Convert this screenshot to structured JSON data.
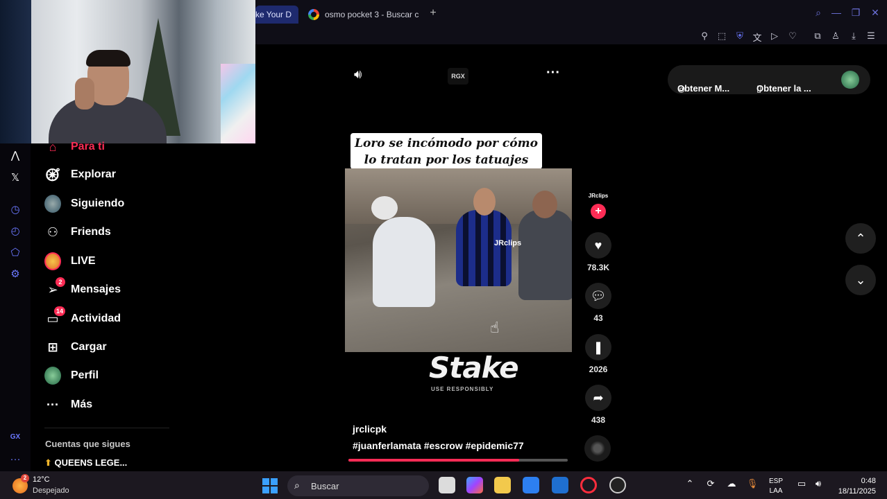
{
  "browser": {
    "tabs": [
      {
        "label": "ke Your D",
        "active": true
      },
      {
        "label": "osmo pocket 3 - Buscar c",
        "active": false
      }
    ],
    "new_tab_icon": "plus-icon"
  },
  "sidebar": {
    "items": [
      {
        "label": "Para ti",
        "icon": "home-icon",
        "active": true
      },
      {
        "label": "Explorar",
        "icon": "compass-icon"
      },
      {
        "label": "Siguiendo",
        "icon": "avatar"
      },
      {
        "label": "Friends",
        "icon": "friends-icon"
      },
      {
        "label": "LIVE",
        "icon": "live-avatar"
      },
      {
        "label": "Mensajes",
        "icon": "send-icon",
        "badge": "2"
      },
      {
        "label": "Actividad",
        "icon": "inbox-icon",
        "badge": "14"
      },
      {
        "label": "Cargar",
        "icon": "upload-icon"
      },
      {
        "label": "Perfil",
        "icon": "avatar"
      },
      {
        "label": "Más",
        "icon": "more-icon"
      }
    ],
    "following_header": "Cuentas que sigues",
    "following": [
      {
        "name": "QUEENS LEGE..."
      }
    ]
  },
  "player": {
    "rgx_label": "RGX",
    "caption": "Loro se incómodo por cómo lo tratan por los tatuajes",
    "watermark": "JRclips",
    "ad_brand": "Stake",
    "ad_sub": "USE RESPONSIBLY",
    "author": "jrclicpk",
    "hashtags": "#juanferlamata #escrow #epidemic77",
    "progress": 0.78
  },
  "actions": {
    "creator_label": "JRclips",
    "likes": "78.3K",
    "comments": "43",
    "saves": "2026",
    "shares": "438"
  },
  "top_right": {
    "btn1": "Obtener M...",
    "btn2": "Obtener la ..."
  },
  "taskbar": {
    "temperature": "12°C",
    "weather": "Despejado",
    "weather_badge": "2",
    "search_placeholder": "Buscar",
    "lang_line1": "ESP",
    "lang_line2": "LAA",
    "time": "0:48",
    "date": "18/11/2025"
  },
  "colors": {
    "accent": "#fe2c55",
    "browser_accent": "#6b78ff"
  }
}
